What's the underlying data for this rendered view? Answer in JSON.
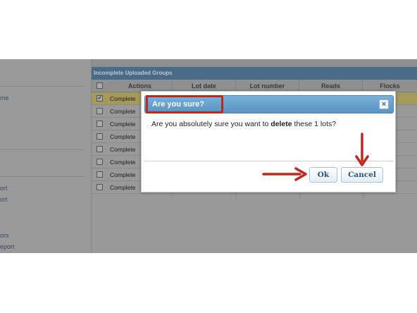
{
  "sidebar": {
    "fragments": [
      "me",
      "ort",
      "ort",
      "ors",
      "eport"
    ]
  },
  "panel": {
    "title": "Incomplete Uploaded Groups",
    "columns": [
      "Actions",
      "Lot date",
      "Lot number",
      "Reads",
      "Flocks"
    ]
  },
  "rows": [
    {
      "action": "Complete",
      "checked": "✔"
    },
    {
      "action": "Complete",
      "checked": ""
    },
    {
      "action": "Complete",
      "checked": ""
    },
    {
      "action": "Complete",
      "checked": ""
    },
    {
      "action": "Complete",
      "checked": ""
    },
    {
      "action": "Complete",
      "checked": ""
    },
    {
      "action": "Complete",
      "checked": ""
    },
    {
      "action": "Complete",
      "checked": ""
    }
  ],
  "dialog": {
    "title": "Are you sure?",
    "close_label": "×",
    "message_before": "Are you absolutely sure you want to ",
    "message_bold": "delete",
    "message_after": " these 1 lots?",
    "ok_label": "Ok",
    "cancel_label": "Cancel"
  },
  "colors": {
    "annotation_red": "#c0281c",
    "title_blue": "#5a94c4"
  },
  "icons": {
    "close": "close-icon",
    "annotation_arrows": "arrow-icon"
  }
}
